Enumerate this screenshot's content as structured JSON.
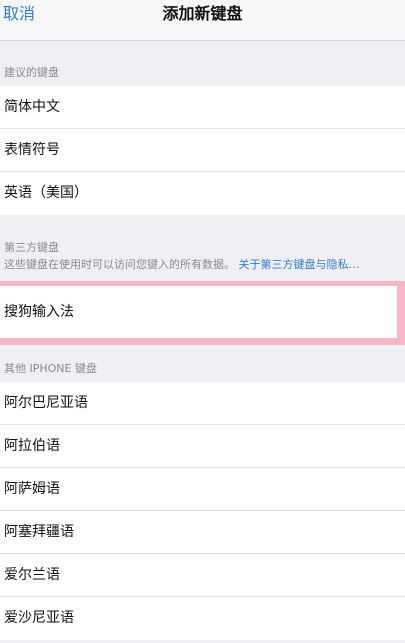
{
  "nav": {
    "cancel": "取消",
    "title": "添加新键盘"
  },
  "suggested": {
    "header": "建议的键盘",
    "items": [
      "简体中文",
      "表情符号",
      "英语（美国）"
    ]
  },
  "third_party": {
    "header": "第三方键盘",
    "description": "这些键盘在使用时可以访问您键入的所有数据。",
    "link": "关于第三方键盘与隐私…",
    "items": [
      "搜狗输入法"
    ]
  },
  "other": {
    "header": "其他 IPHONE 键盘",
    "items": [
      "阿尔巴尼亚语",
      "阿拉伯语",
      "阿萨姆语",
      "阿塞拜疆语",
      "爱尔兰语",
      "爱沙尼亚语"
    ]
  },
  "colors": {
    "accent": "#2f7bd8",
    "highlight": "#f6b6c6",
    "background": "#efeff4"
  }
}
